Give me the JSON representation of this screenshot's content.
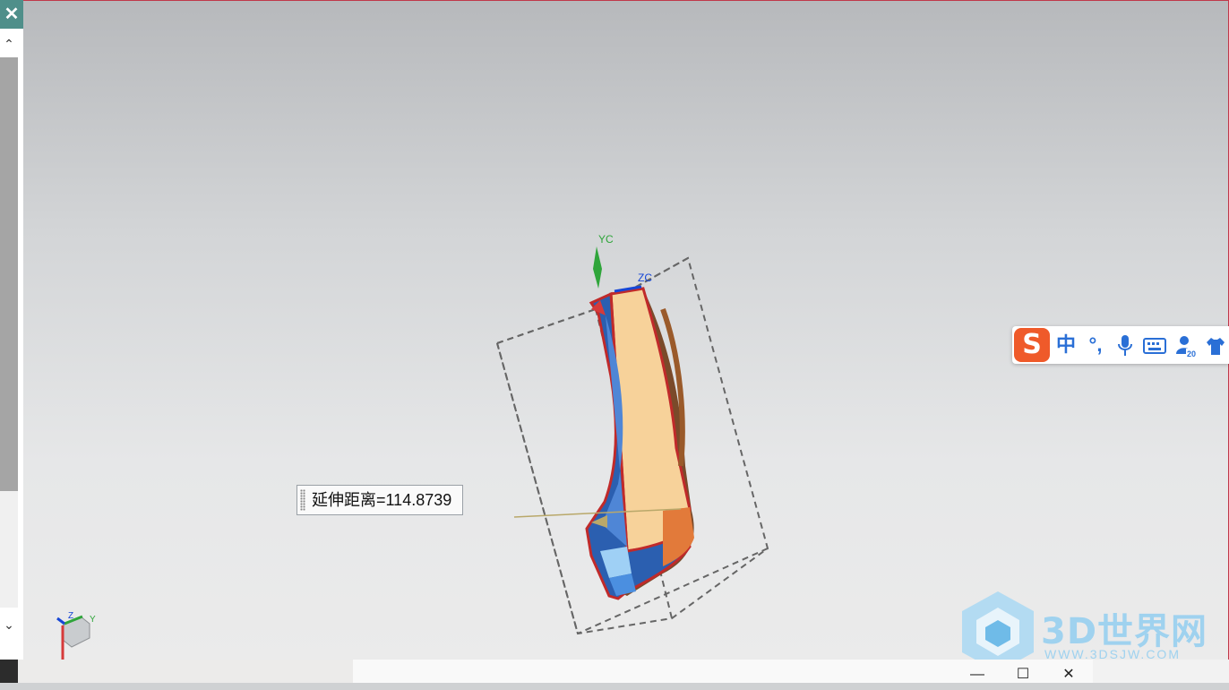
{
  "panel": {
    "close_glyph": "✕",
    "scroll_up_glyph": "⌃",
    "scroll_down_glyph": "⌄"
  },
  "viewport": {
    "axis_labels": {
      "yc": "YC",
      "zc": "ZC"
    },
    "triad_labels": {
      "z": "Z",
      "y": "Y"
    },
    "dimension_label": "延伸距离=114.8739",
    "colors": {
      "background_top": "#b7b9bc",
      "background_bottom": "#ebebeb",
      "part_blue": "#2b5fb0",
      "part_tan": "#f7d29a",
      "edge_red": "#c02a2a",
      "bbox_dash": "#666666"
    }
  },
  "ime": {
    "logo": "S",
    "mode": "中",
    "punct": "°,",
    "icons": [
      "microphone-icon",
      "keyboard-icon",
      "user-icon",
      "skin-shirt-icon"
    ]
  },
  "watermark": {
    "brand": "3D世界网",
    "url": "WWW.3DSJW.COM"
  },
  "window_controls": {
    "minimize": "—",
    "maximize": "☐",
    "close": "✕"
  }
}
